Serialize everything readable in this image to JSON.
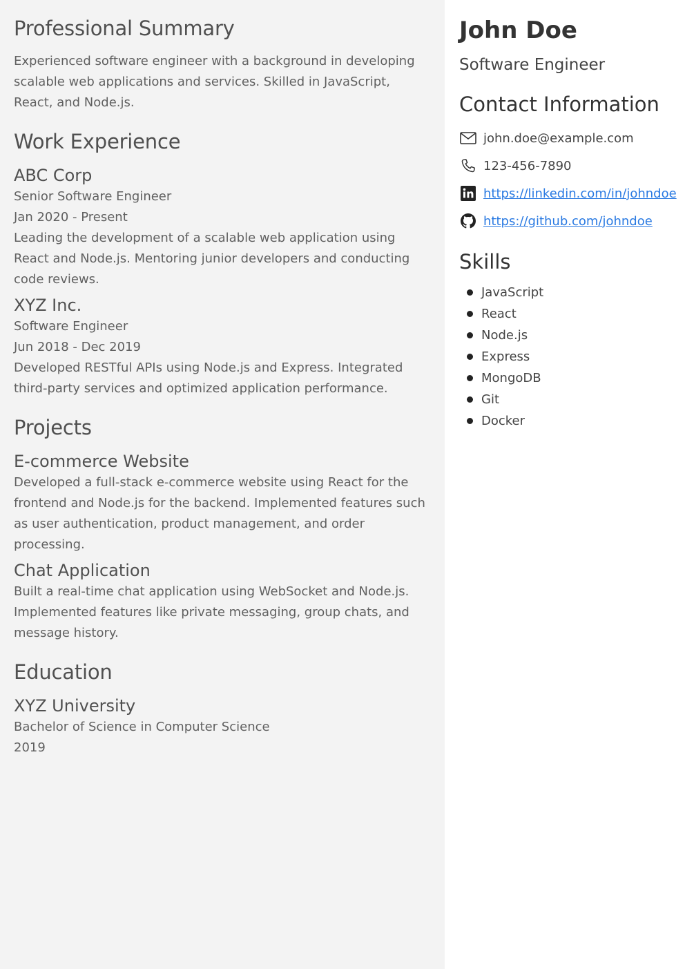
{
  "summary": {
    "heading": "Professional Summary",
    "text": "Experienced software engineer with a background in developing scalable web applications and services. Skilled in JavaScript, React, and Node.js."
  },
  "experience": {
    "heading": "Work Experience",
    "jobs": [
      {
        "company": "ABC Corp",
        "role": "Senior Software Engineer",
        "dates": "Jan 2020 - Present",
        "description": "Leading the development of a scalable web application using React and Node.js. Mentoring junior developers and conducting code reviews."
      },
      {
        "company": "XYZ Inc.",
        "role": "Software Engineer",
        "dates": "Jun 2018 - Dec 2019",
        "description": "Developed RESTful APIs using Node.js and Express. Integrated third-party services and optimized application performance."
      }
    ]
  },
  "projects": {
    "heading": "Projects",
    "items": [
      {
        "name": "E-commerce Website",
        "description": "Developed a full-stack e-commerce website using React for the frontend and Node.js for the backend. Implemented features such as user authentication, product management, and order processing."
      },
      {
        "name": "Chat Application",
        "description": "Built a real-time chat application using WebSocket and Node.js. Implemented features like private messaging, group chats, and message history."
      }
    ]
  },
  "education": {
    "heading": "Education",
    "school": "XYZ University",
    "degree": "Bachelor of Science in Computer Science",
    "year": "2019"
  },
  "profile": {
    "name": "John Doe",
    "title": "Software Engineer"
  },
  "contact": {
    "heading": "Contact Information",
    "email": "john.doe@example.com",
    "phone": "123-456-7890",
    "linkedin": "https://linkedin.com/in/johndoe",
    "github": "https://github.com/johndoe",
    "icons": [
      "mail-icon",
      "phone-icon",
      "linkedin-icon",
      "github-icon"
    ],
    "link_color": "#2a7ae2"
  },
  "skills": {
    "heading": "Skills",
    "items": [
      "JavaScript",
      "React",
      "Node.js",
      "Express",
      "MongoDB",
      "Git",
      "Docker"
    ]
  },
  "colors": {
    "left_panel_bg": "#f3f3f3",
    "right_panel_bg": "#ffffff"
  }
}
